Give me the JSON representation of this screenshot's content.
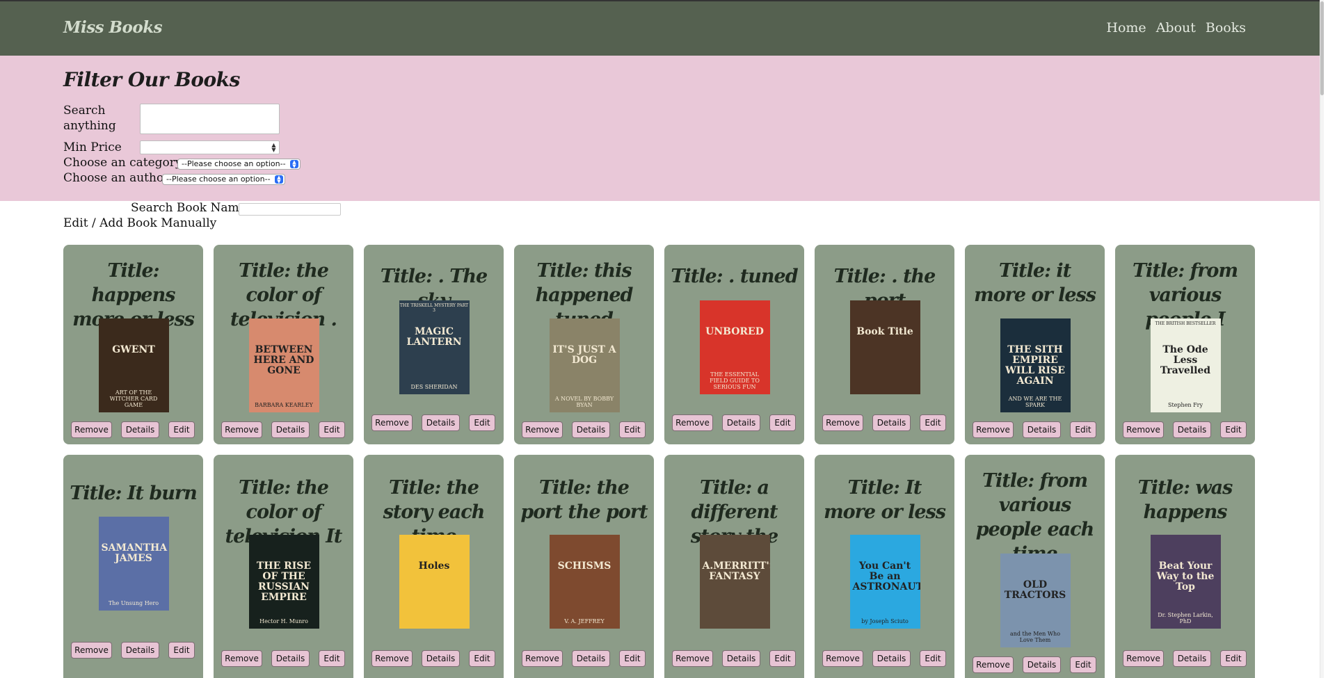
{
  "header": {
    "logo": "Miss Books",
    "nav": [
      "Home",
      "About",
      "Books"
    ]
  },
  "filter": {
    "heading": "Filter Our Books",
    "search_label": "Search anything",
    "search_value": "",
    "min_price_label": "Min Price",
    "min_price_value": "",
    "category_label": "Choose an category:",
    "category_selected": "--Please choose an option--",
    "author_label": "Choose an author:",
    "author_selected": "--Please choose an option--"
  },
  "search_book_name_label": "Search Book Name:",
  "search_book_name_value": "",
  "manual_link": "Edit / Add Book Manually",
  "buttons": {
    "remove": "Remove",
    "details": "Details",
    "edit": "Edit"
  },
  "books": [
    {
      "title": "Title: happens more or less",
      "cover_text": "GWENT",
      "cover_sub": "ART OF THE WITCHER CARD GAME",
      "cover_color": "#3b2a1c"
    },
    {
      "title": "Title: the color of television .",
      "cover_text": "BETWEEN HERE AND GONE",
      "cover_sub": "BARBARA KEARLEY",
      "cover_color": "#d78a6e"
    },
    {
      "title": "Title: . The sky",
      "cover_text": "MAGIC LANTERN",
      "cover_sub": "DES SHERIDAN",
      "cover_top": "THE TRISKELL MYSTERY PART 3",
      "cover_color": "#2d3f4e"
    },
    {
      "title": "Title: this happened tuned",
      "cover_text": "IT'S JUST A DOG",
      "cover_sub": "A NOVEL BY BOBBY BYAN",
      "cover_color": "#8a8368"
    },
    {
      "title": "Title: . tuned",
      "cover_text": "UNBORED",
      "cover_sub": "THE ESSENTIAL FIELD GUIDE TO SERIOUS FUN",
      "cover_color": "#d8342a"
    },
    {
      "title": "Title: . the port",
      "cover_text": "Book Title",
      "cover_sub": "",
      "cover_color": "#4c3425"
    },
    {
      "title": "Title: it more or less",
      "cover_text": "THE SITH EMPIRE WILL RISE AGAIN",
      "cover_sub": "AND WE ARE THE SPARK",
      "cover_color": "#1b2e3c"
    },
    {
      "title": "Title: from various people I",
      "cover_text": "The Ode Less Travelled",
      "cover_sub": "Stephen Fry",
      "cover_top": "THE BRITISH BESTSELLER",
      "cover_color": "#eef0e2"
    },
    {
      "title": "Title: It burn",
      "cover_text": "SAMANTHA JAMES",
      "cover_sub": "The Unsung Hero",
      "cover_color": "#5b6fa6"
    },
    {
      "title": "Title: the color of television It",
      "cover_text": "THE RISE OF THE RUSSIAN EMPIRE",
      "cover_sub": "Hector H. Munro",
      "cover_color": "#17211d"
    },
    {
      "title": "Title: the story each time",
      "cover_text": "Holes",
      "cover_sub": "",
      "cover_color": "#f2c23b"
    },
    {
      "title": "Title: the port the port",
      "cover_text": "SCHISMS",
      "cover_sub": "V. A. JEFFREY",
      "cover_color": "#7e4a2f"
    },
    {
      "title": "Title: a different story the story",
      "cover_text": "A.MERRITT'S FANTASY",
      "cover_sub": "",
      "cover_color": "#5d4b3a"
    },
    {
      "title": "Title: It more or less",
      "cover_text": "You Can't Be an ASTRONAUT!",
      "cover_sub": "by Joseph Sciuto",
      "cover_color": "#2ba8e0"
    },
    {
      "title": "Title: from various people each time",
      "cover_text": "OLD TRACTORS",
      "cover_sub": "and the Men Who Love Them",
      "cover_color": "#7c93ad"
    },
    {
      "title": "Title: was happens",
      "cover_text": "Beat Your Way to the Top",
      "cover_sub": "Dr. Stephen Larkin, PhD",
      "cover_color": "#4d3f5e"
    }
  ]
}
